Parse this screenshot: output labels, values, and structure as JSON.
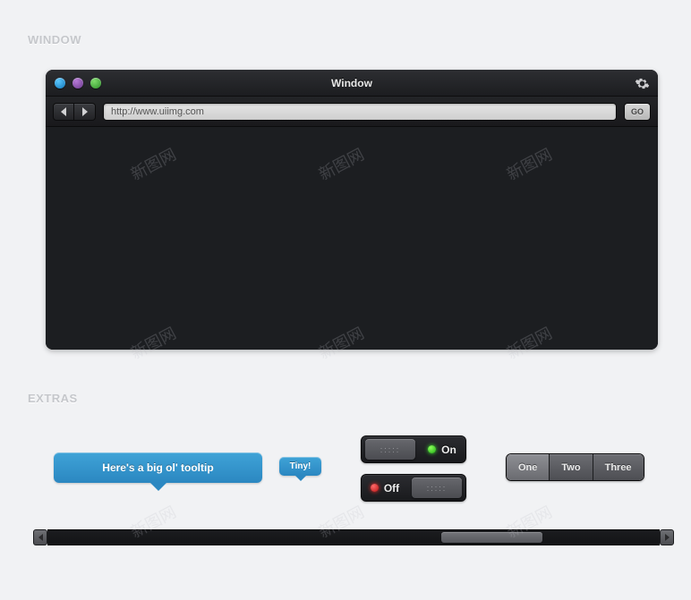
{
  "labels": {
    "window": "WINDOW",
    "extras": "EXTRAS"
  },
  "window": {
    "title": "Window",
    "url": "http://www.uiimg.com",
    "go": "GO"
  },
  "tooltips": {
    "big": "Here's a big ol' tooltip",
    "small": "Tiny!"
  },
  "toggle": {
    "on": "On",
    "off": "Off",
    "knob": ":::::"
  },
  "segments": [
    "One",
    "Two",
    "Three"
  ],
  "segmentActive": 0,
  "watermark": "新图网"
}
